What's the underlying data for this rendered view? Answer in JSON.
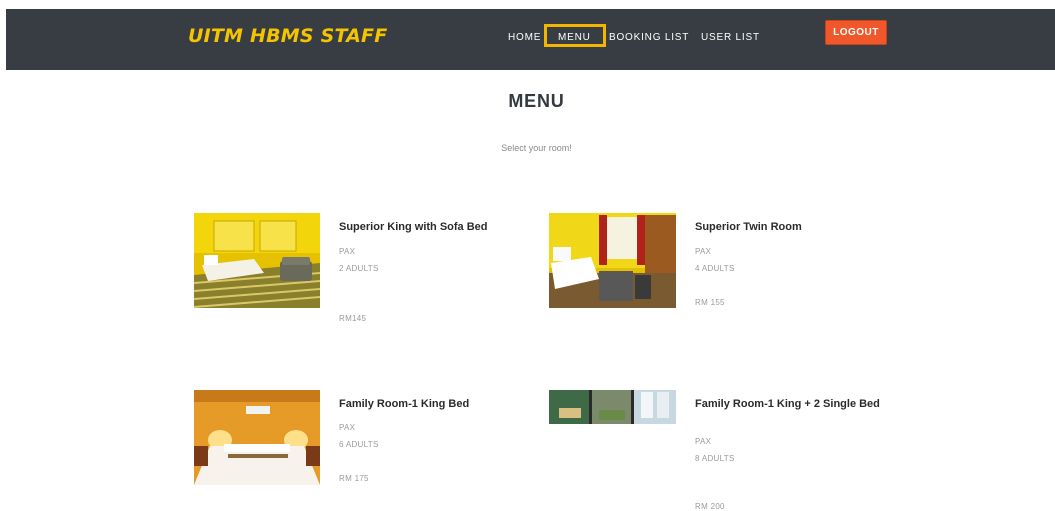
{
  "navbar": {
    "brand": "UITM HBMS STAFF",
    "links": [
      "HOME",
      "MENU",
      "BOOKING LIST",
      "USER LIST"
    ],
    "active": "MENU",
    "logout_label": "LOGOUT"
  },
  "main": {
    "title": "MENU",
    "subtitle": "Select your room!"
  },
  "rooms": [
    {
      "name": "Superior King with Sofa Bed",
      "pax_label": "PAX",
      "pax": "2 ADULTS",
      "price": "RM145"
    },
    {
      "name": "Superior Twin Room",
      "pax_label": "PAX",
      "pax": "4 ADULTS",
      "price": "RM 155"
    },
    {
      "name": "Family Room-1 King Bed",
      "pax_label": "PAX",
      "pax": "6 ADULTS",
      "price": "RM 175"
    },
    {
      "name": "Family Room-1 King + 2 Single Bed",
      "pax_label": "PAX",
      "pax": "8 ADULTS",
      "price": "RM 200"
    }
  ],
  "colors": {
    "navbar": "#383d43",
    "brand": "#f5c400",
    "logout": "#f0572a",
    "highlight": "#f2b600"
  }
}
